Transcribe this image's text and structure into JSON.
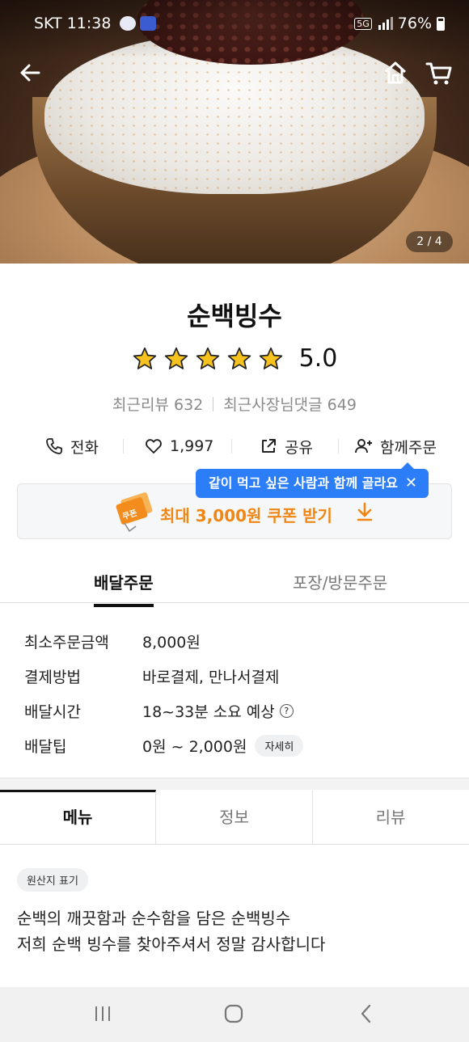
{
  "status_bar": {
    "carrier_time": "SKT 11:38",
    "network": "5G",
    "battery": "76%"
  },
  "hero": {
    "image_counter": "2 / 4"
  },
  "store": {
    "name": "순백빙수",
    "rating": "5.0",
    "stars": 5,
    "recent_reviews": "최근리뷰 632",
    "owner_replies": "최근사장님댓글 649"
  },
  "actions": {
    "call": "전화",
    "likes": "1,997",
    "share": "공유",
    "group_order": "함께주문"
  },
  "tooltip": {
    "text": "같이 먹고 싶은 사람과 함께 골라요"
  },
  "coupon": {
    "ticket_text": "쿠폰",
    "label": "최대 3,000원 쿠폰 받기"
  },
  "order_tabs": {
    "active": "배달주문",
    "inactive": "포장/방문주문"
  },
  "delivery_info": [
    {
      "key": "최소주문금액",
      "value": "8,000원"
    },
    {
      "key": "결제방법",
      "value": "바로결제, 만나서결제"
    },
    {
      "key": "배달시간",
      "value": "18~33분 소요 예상"
    },
    {
      "key": "배달팁",
      "value": "0원 ~ 2,000원"
    }
  ],
  "detail_button": "자세히",
  "menu_tabs": [
    "메뉴",
    "정보",
    "리뷰"
  ],
  "origin_badge": "원산지 표기",
  "description": [
    "순백의 깨끗함과 순수함을 담은 순백빙수",
    "저희 순백 빙수를 찾아주셔서 정말 감사합니다"
  ],
  "colors": {
    "accent_orange": "#f08613",
    "tooltip_blue": "#2c7ef8",
    "star_yellow": "#f7c21e"
  }
}
